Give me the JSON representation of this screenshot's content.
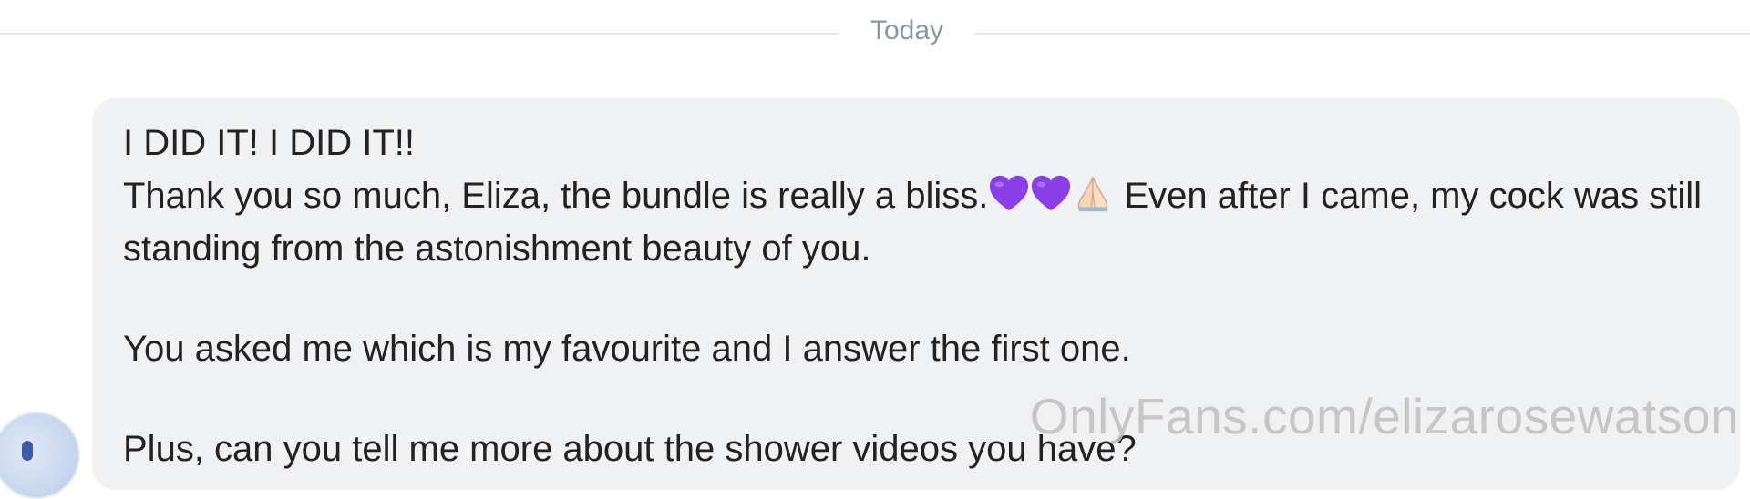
{
  "date_divider": {
    "label": "Today"
  },
  "message": {
    "line1": "I DID IT! I DID IT!!",
    "line2_before_emoji": "Thank you so much, Eliza, the bundle is really a bliss.",
    "emojis": [
      "purple-heart-icon",
      "purple-heart-icon",
      "folded-hands-icon"
    ],
    "line2_after_emoji": " Even after I came, my cock was still standing from the astonishment beauty of you.",
    "paragraph2": "You asked me which is my favourite and I answer the first one.",
    "paragraph3": "Plus, can you tell me more about the shower videos you have?"
  },
  "watermark": {
    "text": "OnlyFans.com/elizarosewatson"
  },
  "colors": {
    "bubble_bg": "#f0f1f3",
    "divider_text": "#8a96a3",
    "heart": "#8a3ee8",
    "text": "#222222"
  }
}
